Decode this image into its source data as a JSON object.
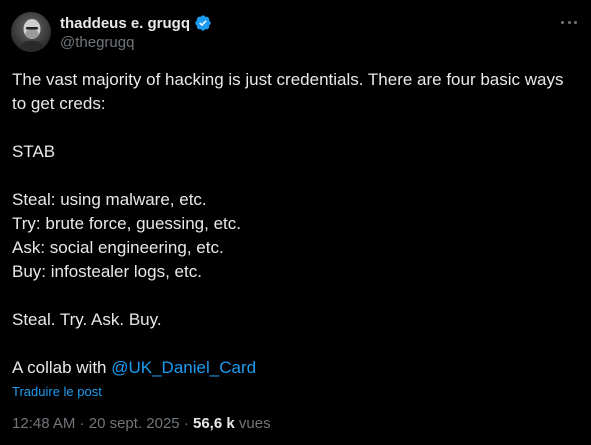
{
  "author": {
    "display_name": "thaddeus e. grugq",
    "handle": "@thegrugq",
    "avatar_icon": "profile-photo",
    "verified_icon": "verified-badge-icon",
    "verified_color": "#1d9bf0"
  },
  "header": {
    "more_icon": "more-options-icon"
  },
  "post": {
    "line1": "The vast majority of hacking is just credentials. There are four basic ways",
    "line2": "to get creds:",
    "stab": "STAB",
    "steal": "Steal: using malware, etc.",
    "try": "Try: brute force, guessing, etc.",
    "ask": "Ask: social engineering, etc.",
    "buy": "Buy: infostealer logs, etc.",
    "summary": "Steal. Try. Ask. Buy.",
    "collab_prefix": "A collab with ",
    "mention": "@UK_Daniel_Card",
    "mention_color": "#1d9bf0"
  },
  "translate_label": "Traduire le post",
  "meta": {
    "time": "12:48 AM",
    "separator": " · ",
    "date": "20 sept. 2025",
    "separator2": " · ",
    "views_count": "56,6 k",
    "views_label": " vues"
  },
  "colors": {
    "background": "#000000",
    "text": "#e7e9ea",
    "secondary": "#71767b",
    "accent": "#1d9bf0"
  }
}
